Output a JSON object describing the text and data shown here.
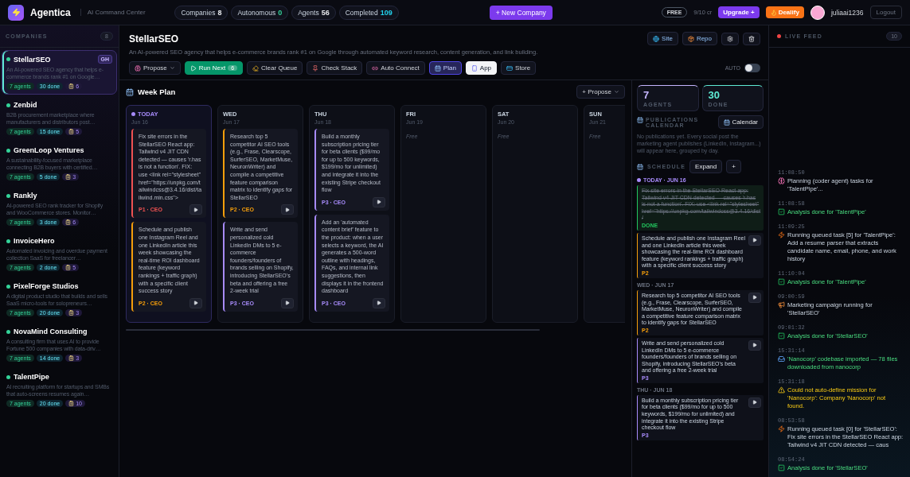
{
  "topbar": {
    "brand": "Agentica",
    "subtitle": "AI Command Center",
    "stats": [
      {
        "label": "Companies",
        "value": "8",
        "color": "#e5e7eb"
      },
      {
        "label": "Autonomous",
        "value": "0",
        "color": "#34d399"
      },
      {
        "label": "Agents",
        "value": "56",
        "color": "#e5e7eb"
      },
      {
        "label": "Completed",
        "value": "109",
        "color": "#22d3ee"
      }
    ],
    "new_company": "+ New Company",
    "plan": "FREE",
    "credits": "9/10 cr",
    "upgrade": "Upgrade +",
    "dealify": "Dealify",
    "username": "juliaai1236",
    "logout": "Logout"
  },
  "sidebar": {
    "title": "COMPANIES",
    "count": "8",
    "companies": [
      {
        "name": "StellarSEO",
        "badge": "GH",
        "description": "An AI-powered SEO agency that helps e-commerce brands rank #1 on Google…",
        "agents": "7 agents",
        "done": "30 done",
        "tasks": "6",
        "selected": true
      },
      {
        "name": "Zenbid",
        "description": "B2B procurement marketplace where manufacturers and distributors post…",
        "agents": "7 agents",
        "done": "15 done",
        "tasks": "5",
        "selected": false
      },
      {
        "name": "GreenLoop Ventures",
        "description": "A sustainability-focused marketplace connecting B2B buyers with certified…",
        "agents": "7 agents",
        "done": "5 done",
        "tasks": "3",
        "selected": false
      },
      {
        "name": "Rankly",
        "description": "AI-powered SEO rank tracker for Shopify and WooCommerce stores. Monitor…",
        "agents": "7 agents",
        "done": "3 done",
        "tasks": "6",
        "selected": false
      },
      {
        "name": "InvoiceHero",
        "description": "Automated invoicing and overdue payment collection SaaS for freelancer…",
        "agents": "7 agents",
        "done": "2 done",
        "tasks": "5",
        "selected": false
      },
      {
        "name": "PixelForge Studios",
        "description": "A digital product studio that builds and sells SaaS micro-tools for solopreneurs…",
        "agents": "7 agents",
        "done": "20 done",
        "tasks": "3",
        "selected": false
      },
      {
        "name": "NovaMind Consulting",
        "description": "A consulting firm that uses AI to provide Fortune 500 companies with data-driv…",
        "agents": "7 agents",
        "done": "14 done",
        "tasks": "3",
        "selected": false
      },
      {
        "name": "TalentPipe",
        "description": "AI recruiting platform for startups and SMBs that auto-screens resumes again…",
        "agents": "7 agents",
        "done": "20 done",
        "tasks": "10",
        "selected": false
      }
    ]
  },
  "company": {
    "name": "StellarSEO",
    "description": "An AI-powered SEO agency that helps e-commerce brands rank #1 on Google through automated keyword research, content generation, and link building.",
    "links": [
      {
        "label": "Site"
      },
      {
        "label": "Repo"
      }
    ],
    "actions": [
      {
        "label": "Propose",
        "kind": "dropdown"
      },
      {
        "label": "Run Next",
        "kind": "primary",
        "count": "6"
      },
      {
        "label": "Clear Queue",
        "kind": "plain"
      },
      {
        "label": "Check Stack",
        "kind": "plain"
      },
      {
        "label": "Auto Connect",
        "kind": "plain"
      },
      {
        "label": "Plan",
        "kind": "view",
        "selected": true
      },
      {
        "label": "App",
        "kind": "view",
        "selected": false
      },
      {
        "label": "Store",
        "kind": "plain"
      }
    ],
    "auto": {
      "label": "AUTO",
      "on": false
    }
  },
  "week_plan": {
    "title": "Week Plan",
    "propose": "+ Propose",
    "days": [
      {
        "day": "TODAY",
        "date": "Jun 16",
        "today": true,
        "tasks": [
          {
            "text": "Fix site errors in the StellarSEO React app: Tailwind v4 JIT CDN detected — causes 'r.has is not a function'. FIX: use <link rel=\"stylesheet\" href=\"https://unpkg.com/tailwindcss@3.4.16/dist/tailwind.min.css\">",
            "meta": "P1 · CEO",
            "color": "#f05252"
          },
          {
            "text": "Schedule and publish one Instagram Reel and one LinkedIn article this week showcasing the real-time ROI dashboard feature (keyword rankings + traffic graph) with a specific client success story",
            "meta": "P2 · CEO",
            "color": "#f59e0b"
          }
        ]
      },
      {
        "day": "WED",
        "date": "Jun 17",
        "today": false,
        "tasks": [
          {
            "text": "Research top 5 competitor AI SEO tools (e.g., Frase, Clearscope, SurferSEO, MarketMuse, NeuronWriter) and compile a competitive feature comparison matrix to identify gaps for StellarSEO",
            "meta": "P2 · CEO",
            "color": "#f59e0b"
          },
          {
            "text": "Write and send personalized cold LinkedIn DMs to 5 e-commerce founders/founders of brands selling on Shopify, introducing StellarSEO's beta and offering a free 2-week trial",
            "meta": "P3 · CEO",
            "color": "#a78bfa"
          }
        ]
      },
      {
        "day": "THU",
        "date": "Jun 18",
        "today": false,
        "tasks": [
          {
            "text": "Build a monthly subscription pricing tier for beta clients ($99/mo for up to 500 keywords, $199/mo for unlimited) and integrate it into the existing Stripe checkout flow",
            "meta": "P3 · CEO",
            "color": "#a78bfa"
          },
          {
            "text": "Add an 'automated content brief' feature to the product: when a user selects a keyword, the AI generates a 500-word outline with headings, FAQs, and internal link suggestions, then displays it in the frontend dashboard",
            "meta": "P3 · CEO",
            "color": "#a78bfa"
          }
        ]
      },
      {
        "day": "FRI",
        "date": "Jun 19",
        "today": false,
        "free": "Free"
      },
      {
        "day": "SAT",
        "date": "Jun 20",
        "today": false,
        "free": "Free"
      },
      {
        "day": "SUN",
        "date": "Jun 21",
        "today": false,
        "free": "Free"
      }
    ]
  },
  "stats": [
    {
      "value": "7",
      "label": "AGENTS",
      "color": "#c4b5fd"
    },
    {
      "value": "30",
      "label": "DONE",
      "color": "#5eead4"
    }
  ],
  "publications": {
    "title": "PUBLICATIONS CALENDAR",
    "button": "Calendar",
    "empty": "No publications yet. Every social post the marketing agent publishes (LinkedIn, Instagram...) will appear here, grouped by day."
  },
  "schedule": {
    "title": "SCHEDULE",
    "expand": "Expand",
    "add": "+",
    "groups": [
      {
        "label": "TODAY · JUN 16",
        "today": true,
        "items": [
          {
            "text": "Fix site errors in the StellarSEO React app: Tailwind v4 JIT CDN detected — causes 'r.has is not a function'. FIX: use <link rel=\"stylesheet\" href=\"https://unpkg.com/tailwindcss@3.4.16/dist/",
            "label": "DONE",
            "color": "#22c55e",
            "done": true
          },
          {
            "text": "Schedule and publish one Instagram Reel and one LinkedIn article this week showcasing the real-time ROI dashboard feature (keyword rankings + traffic graph) with a specific client success story",
            "label": "P2",
            "color": "#f59e0b",
            "done": false
          }
        ]
      },
      {
        "label": "WED · JUN 17",
        "today": false,
        "items": [
          {
            "text": "Research top 5 competitor AI SEO tools (e.g., Frase, Clearscope, SurferSEO, MarketMuse, NeuronWriter) and compile a competitive feature comparison matrix to identify gaps for StellarSEO",
            "label": "P2",
            "color": "#f59e0b",
            "done": false
          },
          {
            "text": "Write and send personalized cold LinkedIn DMs to 5 e-commerce founders/founders of brands selling on Shopify, introducing StellarSEO's beta and offering a free 2-week trial",
            "label": "P3",
            "color": "#a78bfa",
            "done": false
          }
        ]
      },
      {
        "label": "THU · JUN 18",
        "today": false,
        "items": [
          {
            "text": "Build a monthly subscription pricing tier for beta clients ($99/mo for up to 500 keywords, $199/mo for unlimited) and integrate it into the existing Stripe checkout flow",
            "label": "P3",
            "color": "#a78bfa",
            "done": false
          }
        ]
      }
    ]
  },
  "feed": {
    "title": "LIVE FEED",
    "count": "10",
    "entries": [
      {
        "time": "11:08:50",
        "kind": "planning",
        "text": "Planning (coder agent) tasks for 'TalentPipe'..."
      },
      {
        "time": "11:08:58",
        "kind": "analysis",
        "text": "Analysis done for 'TalentPipe'"
      },
      {
        "time": "11:09:25",
        "kind": "task",
        "text": "Running queued task [5] for 'TalentPipe': Add a resume parser that extracts candidate name, email, phone, and work history"
      },
      {
        "time": "11:10:04",
        "kind": "analysis",
        "text": "Analysis done for 'TalentPipe'"
      },
      {
        "time": "09:00:59",
        "kind": "campaign",
        "text": "Marketing campaign running for 'StellarSEO'"
      },
      {
        "time": "09:01:32",
        "kind": "analysis",
        "text": "Analysis done for 'StellarSEO'"
      },
      {
        "time": "15:31:14",
        "kind": "import",
        "text": "'Nanocorp' codebase imported — 78 files downloaded from nanocorp"
      },
      {
        "time": "15:31:18",
        "kind": "error",
        "text": "Could not auto-define mission for 'Nanocorp': Company 'Nanocorp' not found."
      },
      {
        "time": "08:53:58",
        "kind": "task",
        "text": "Running queued task [0] for 'StellarSEO': Fix site errors in the StellarSEO React app: Tailwind v4 JIT CDN detected — caus"
      },
      {
        "time": "08:54:24",
        "kind": "analysis",
        "text": "Analysis done for 'StellarSEO'"
      }
    ]
  }
}
